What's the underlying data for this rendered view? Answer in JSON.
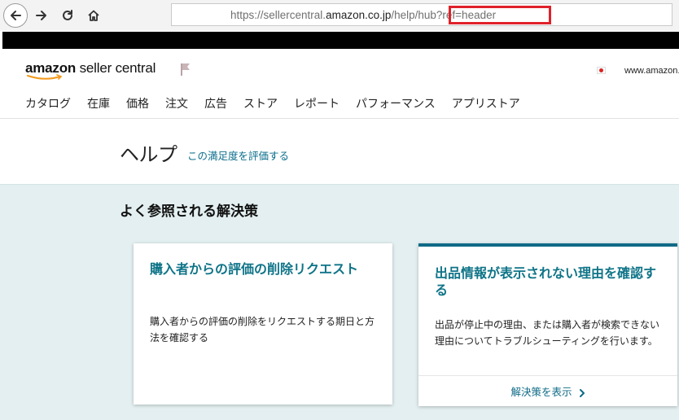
{
  "browser": {
    "url_prefix": "https://sellercentral.",
    "url_domain": "amazon.co.jp",
    "url_path": "/help/",
    "url_highlight": "hub?ref=header"
  },
  "header": {
    "logo_amazon": "amazon",
    "logo_suffix": " seller central",
    "site_link": "www.amazon.co.jp",
    "nav": [
      "カタログ",
      "在庫",
      "価格",
      "注文",
      "広告",
      "ストア",
      "レポート",
      "パフォーマンス",
      "アプリストア"
    ]
  },
  "help": {
    "title": "ヘルプ",
    "rate_link": "この満足度を評価する"
  },
  "solutions": {
    "heading": "よく参照される解決策",
    "cards": [
      {
        "title": "購入者からの評価の削除リクエスト",
        "description": "購入者からの評価の削除をリクエストする期日と方法を確認する"
      },
      {
        "title": "出品情報が表示されない理由を確認する",
        "description": "出品が停止中の理由、または購入者が検索できない理由についてトラブルシューティングを行います。",
        "link": "解決策を表示"
      }
    ]
  },
  "colors": {
    "accent_teal": "#0f7488",
    "section_bg": "#e3eff0",
    "highlight_red": "#e0212a"
  }
}
